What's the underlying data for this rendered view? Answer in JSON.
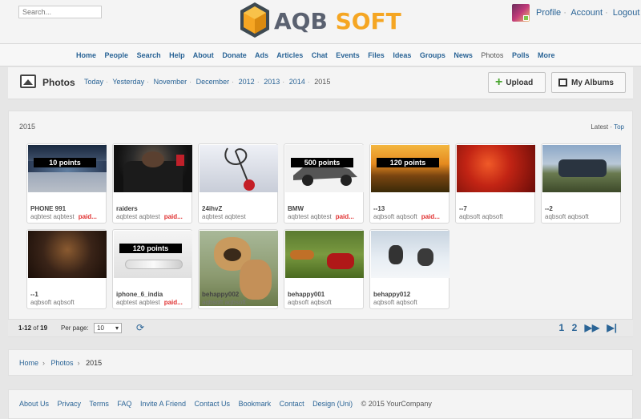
{
  "search": {
    "placeholder": "Search..."
  },
  "brand": {
    "part1": "AQB",
    "part2": "SOFT"
  },
  "user_links": [
    "Profile",
    "Account",
    "Logout"
  ],
  "nav": [
    "Home",
    "People",
    "Search",
    "Help",
    "About",
    "Donate",
    "Ads",
    "Articles",
    "Chat",
    "Events",
    "Files",
    "Ideas",
    "Groups",
    "News",
    "Photos",
    "Polls",
    "More"
  ],
  "nav_current": "Photos",
  "page": {
    "title": "Photos",
    "crumbs": [
      "Today",
      "Yesterday",
      "November",
      "December",
      "2012",
      "2013",
      "2014"
    ],
    "crumb_current": "2015",
    "upload_label": "Upload",
    "albums_label": "My Albums"
  },
  "content": {
    "year": "2015",
    "sort_latest": "Latest",
    "sort_top": "Top"
  },
  "photos": [
    {
      "title": "PHONE 991",
      "meta": "aqbtest aqbtest",
      "paid": "paid...",
      "points": "10 points"
    },
    {
      "title": "raiders",
      "meta": "aqbtest aqbtest",
      "paid": "paid...",
      "points": ""
    },
    {
      "title": "24ihvZ",
      "meta": "aqbtest aqbtest",
      "paid": "",
      "points": ""
    },
    {
      "title": "BMW",
      "meta": "aqbtest aqbtest",
      "paid": "paid...",
      "points": "500 points"
    },
    {
      "title": "--13",
      "meta": "aqbsoft aqbsoft",
      "paid": "paid...",
      "points": "120 points"
    },
    {
      "title": "--7",
      "meta": "aqbsoft aqbsoft",
      "paid": "",
      "points": ""
    },
    {
      "title": "--2",
      "meta": "aqbsoft aqbsoft",
      "paid": "",
      "points": ""
    },
    {
      "title": "--1",
      "meta": "aqbsoft aqbsoft",
      "paid": "",
      "points": ""
    },
    {
      "title": "iphone_6_india",
      "meta": "aqbtest aqbtest",
      "paid": "paid...",
      "points": "120 points"
    },
    {
      "title": "behappy002",
      "meta": "aqbsoft aqbsoft",
      "paid": "",
      "points": ""
    },
    {
      "title": "behappy001",
      "meta": "aqbsoft aqbsoft",
      "paid": "",
      "points": ""
    },
    {
      "title": "behappy012",
      "meta": "aqbsoft aqbsoft",
      "paid": "",
      "points": ""
    }
  ],
  "pager": {
    "range": "1-12",
    "of_label": "of",
    "total": "19",
    "per_page_label": "Per page:",
    "per_page_value": "10",
    "refresh_icon": "refresh-icon",
    "pages": [
      "1",
      "2"
    ],
    "next_icon": "next-icon",
    "last_icon": "last-icon"
  },
  "breadcrumb": [
    "Home",
    "Photos",
    "2015"
  ],
  "footer": {
    "links": [
      "About Us",
      "Privacy",
      "Terms",
      "FAQ",
      "Invite A Friend",
      "Contact Us",
      "Bookmark",
      "Contact",
      "Design (Uni)"
    ],
    "copyright": "© 2015 YourCompany"
  },
  "colors": {
    "link": "#2a6496",
    "paid": "#e03030",
    "accent": "#f5a623"
  }
}
